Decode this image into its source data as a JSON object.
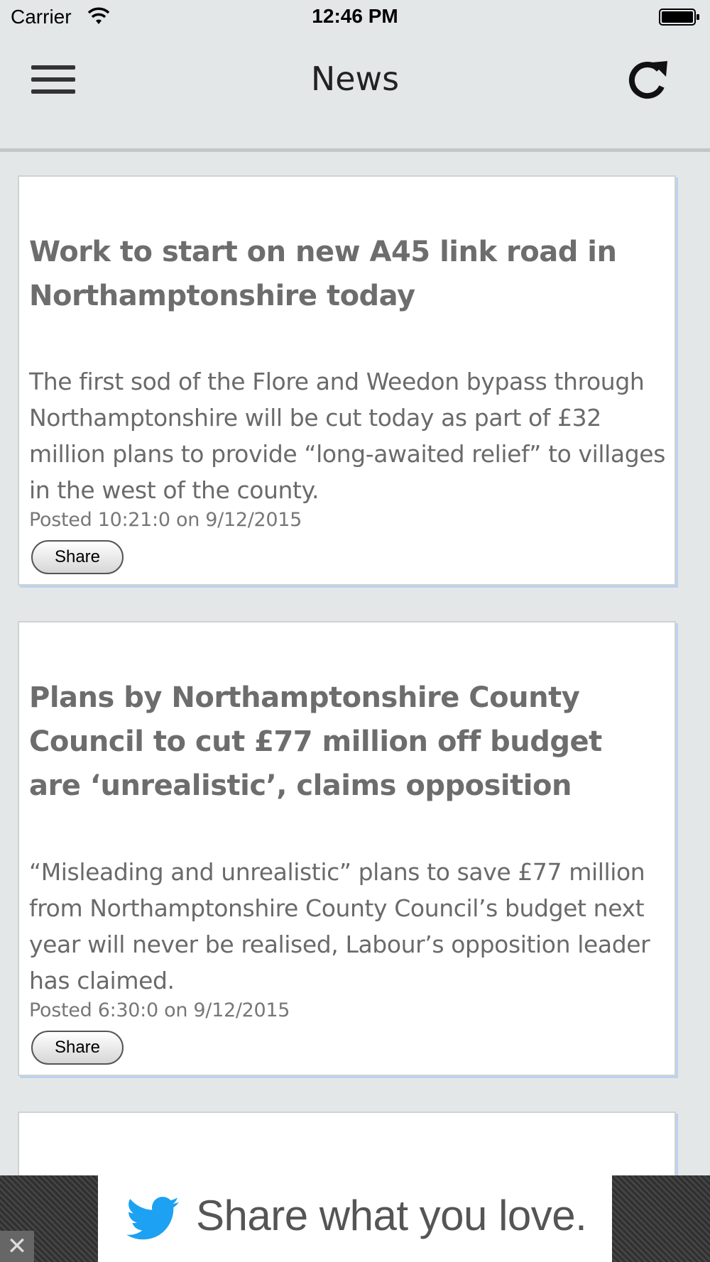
{
  "status_bar": {
    "carrier": "Carrier",
    "time": "12:46 PM",
    "wifi_icon": "wifi-icon",
    "battery_icon": "battery-icon"
  },
  "nav": {
    "title": "News",
    "menu_icon": "hamburger-menu-icon",
    "refresh_icon": "refresh-icon"
  },
  "articles": [
    {
      "headline": "Work to start on new A45 link road in Northamptonshire today",
      "summary": "The first sod of the Flore and Weedon bypass through Northamptonshire will be cut today as part of £32 million plans to provide “long-awaited relief” to villages in the west of the county.",
      "posted": "Posted 10:21:0 on 9/12/2015",
      "share_label": "Share"
    },
    {
      "headline": "Plans by Northamptonshire County Council to cut £77 million off budget are ‘unrealistic’, claims opposition",
      "summary": "“Misleading and unrealistic” plans to save £77 million from Northamptonshire County Council’s budget next year will never be realised, Labour’s opposition leader has claimed.",
      "posted": "Posted 6:30:0 on 9/12/2015",
      "share_label": "Share"
    }
  ],
  "ad": {
    "text": "Share what you love.",
    "close": "✕",
    "brand_icon": "twitter-bird-icon",
    "brand_color": "#1da1f2"
  }
}
